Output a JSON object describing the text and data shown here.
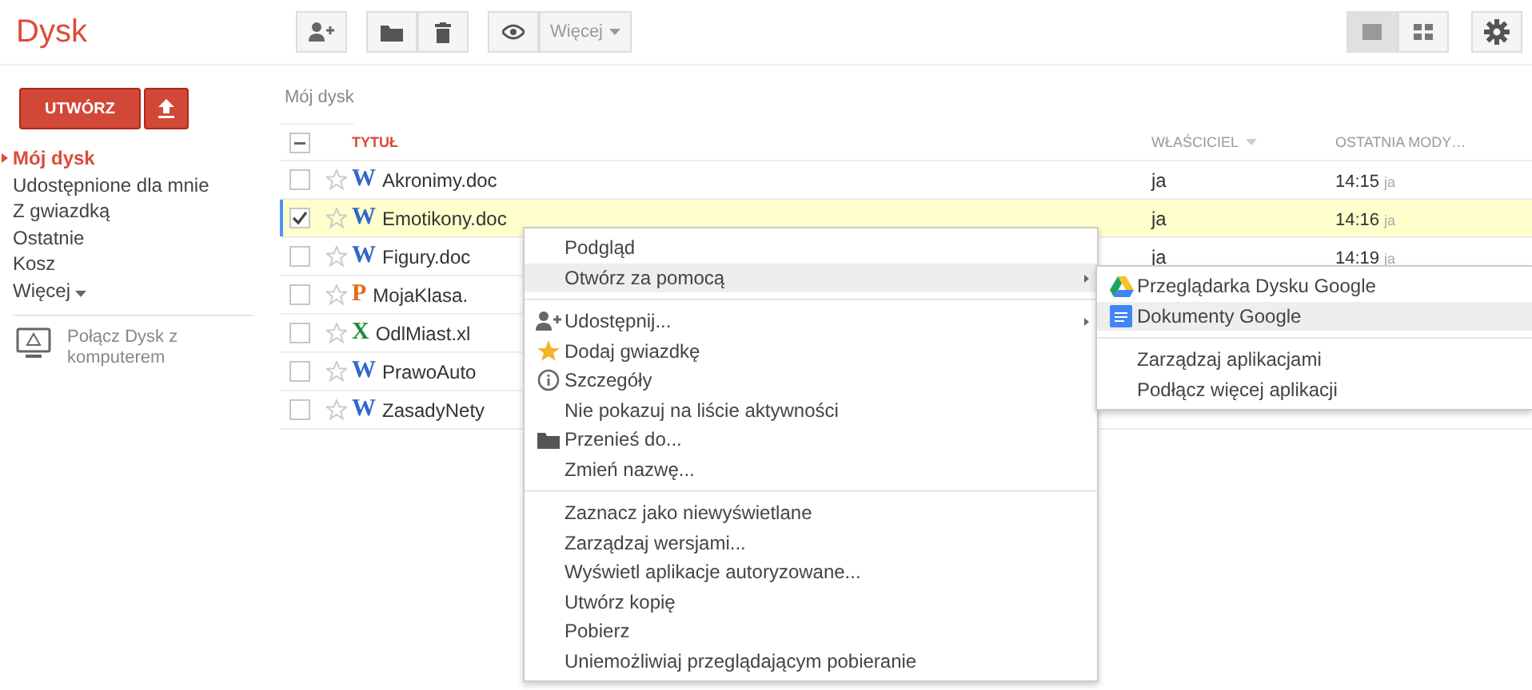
{
  "app": {
    "title": "Dysk"
  },
  "toolbar": {
    "more_label": "Więcej",
    "views": [
      {
        "kind": "list",
        "selected": true
      },
      {
        "kind": "grid",
        "selected": false
      }
    ]
  },
  "sidebar": {
    "create_label": "UTWÓRZ",
    "nav": [
      {
        "label": "Mój dysk",
        "selected": true,
        "dropdown": false
      },
      {
        "label": "Udostępnione dla mnie",
        "selected": false,
        "dropdown": false
      },
      {
        "label": "Z gwiazdką",
        "selected": false,
        "dropdown": false
      },
      {
        "label": "Ostatnie",
        "selected": false,
        "dropdown": false
      },
      {
        "label": "Kosz",
        "selected": false,
        "dropdown": false
      },
      {
        "label": "Więcej",
        "selected": false,
        "dropdown": true
      }
    ],
    "connect": "Połącz Dysk z komputerem"
  },
  "breadcrumb": "Mój dysk",
  "table": {
    "select_all": {
      "partial": true
    },
    "columns": [
      {
        "label": "TYTUŁ",
        "sorted": true,
        "menu": false
      },
      {
        "label": "WŁAŚCICIEL",
        "sorted": false,
        "menu": true
      },
      {
        "label": "OSTATNIA MODY…",
        "sorted": false,
        "menu": false
      }
    ],
    "rows": [
      {
        "kind": "doc",
        "letter": "W",
        "name": "Akronimy.doc",
        "checked": false,
        "starred": false,
        "owner": "ja",
        "modified": "14:15",
        "modified_by": "ja"
      },
      {
        "kind": "doc",
        "letter": "W",
        "name": "Emotikony.doc",
        "checked": true,
        "starred": false,
        "owner": "ja",
        "modified": "14:16",
        "modified_by": "ja"
      },
      {
        "kind": "doc",
        "letter": "W",
        "name": "Figury.doc",
        "checked": false,
        "starred": false,
        "owner": "ja",
        "modified": "14:19",
        "modified_by": "ja"
      },
      {
        "kind": "ppt",
        "letter": "P",
        "name": "MojaKlasa.",
        "checked": false,
        "starred": false
      },
      {
        "kind": "xls",
        "letter": "X",
        "name": "OdlMiast.xl",
        "checked": false,
        "starred": false
      },
      {
        "kind": "doc",
        "letter": "W",
        "name": "PrawoAuto",
        "checked": false,
        "starred": false
      },
      {
        "kind": "doc",
        "letter": "W",
        "name": "ZasadyNety",
        "checked": false,
        "starred": false
      }
    ]
  },
  "context_menu": {
    "groups": [
      [
        {
          "label": "Podgląd",
          "kind": "plain",
          "submenu": false,
          "selected": false
        },
        {
          "label": "Otwórz za pomocą",
          "kind": "plain",
          "submenu": true,
          "selected": true
        }
      ],
      [
        {
          "label": "Udostępnij...",
          "kind": "share",
          "submenu": true,
          "selected": false
        },
        {
          "label": "Dodaj gwiazdkę",
          "kind": "star",
          "submenu": false,
          "selected": false
        },
        {
          "label": "Szczegóły",
          "kind": "info",
          "submenu": false,
          "selected": false
        },
        {
          "label": "Nie pokazuj na liście aktywności",
          "kind": "plain",
          "submenu": false,
          "selected": false
        },
        {
          "label": "Przenieś do...",
          "kind": "folder",
          "submenu": false,
          "selected": false
        },
        {
          "label": "Zmień nazwę...",
          "kind": "plain",
          "submenu": false,
          "selected": false
        }
      ],
      [
        {
          "label": "Zaznacz jako niewyświetlane",
          "kind": "plain",
          "submenu": false,
          "selected": false
        },
        {
          "label": "Zarządzaj wersjami...",
          "kind": "plain",
          "submenu": false,
          "selected": false
        },
        {
          "label": "Wyświetl aplikacje autoryzowane...",
          "kind": "plain",
          "submenu": false,
          "selected": false
        },
        {
          "label": "Utwórz kopię",
          "kind": "plain",
          "submenu": false,
          "selected": false
        },
        {
          "label": "Pobierz",
          "kind": "plain",
          "submenu": false,
          "selected": false
        },
        {
          "label": "Uniemożliwiaj przeglądającym pobieranie",
          "kind": "plain",
          "submenu": false,
          "selected": false
        }
      ]
    ]
  },
  "submenu": {
    "groups": [
      [
        {
          "label": "Przeglądarka Dysku Google",
          "kind": "drive",
          "submenu": false,
          "selected": false
        },
        {
          "label": "Dokumenty Google",
          "kind": "docs",
          "submenu": false,
          "selected": true
        }
      ],
      [
        {
          "label": "Zarządzaj aplikacjami",
          "kind": "plain",
          "submenu": false,
          "selected": false
        },
        {
          "label": "Podłącz więcej aplikacji",
          "kind": "plain",
          "submenu": false,
          "selected": false
        }
      ]
    ]
  }
}
